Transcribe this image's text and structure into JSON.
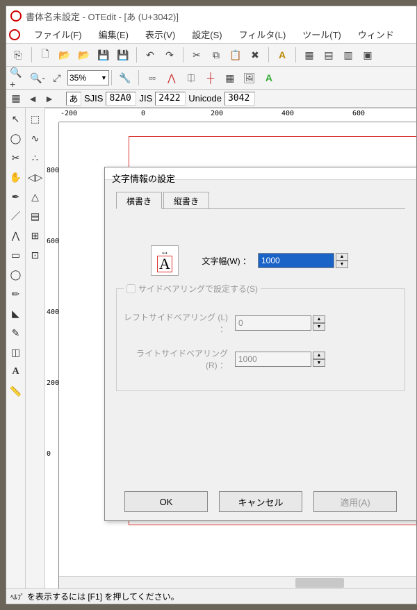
{
  "window": {
    "title": "書体名未設定 - OTEdit - [あ (U+3042)]"
  },
  "menu": {
    "file": "ファイル(F)",
    "edit": "編集(E)",
    "view": "表示(V)",
    "settings": "設定(S)",
    "filter": "フィルタ(L)",
    "tool": "ツール(T)",
    "window": "ウィンド"
  },
  "toolbar2": {
    "zoom": "35%"
  },
  "infobar": {
    "glyph": "あ",
    "enc1_label": "SJIS",
    "enc1_val": "82A0",
    "enc2_label": "JIS",
    "enc2_val": "2422",
    "enc3_label": "Unicode",
    "enc3_val": "3042"
  },
  "ruler_h": [
    "-200",
    "0",
    "200",
    "400",
    "600"
  ],
  "ruler_v": [
    "800",
    "600",
    "400",
    "200",
    "0"
  ],
  "dialog": {
    "title": "文字情報の設定",
    "tabs": {
      "horizontal": "横書き",
      "vertical": "縦書き"
    },
    "preview_letter": "A",
    "width_label": "文字幅(W) ：",
    "width_value": "1000",
    "sidebearing_check": "サイドベアリングで設定する(S)",
    "lsb_label": "レフトサイドベアリング (L) ：",
    "lsb_value": "0",
    "rsb_label": "ライトサイドベアリング (R) ：",
    "rsb_value": "1000",
    "ok": "OK",
    "cancel": "キャンセル",
    "apply": "適用(A)"
  },
  "status": {
    "hint_label": "ﾍﾙﾌﾟ",
    "hint": "を表示するには [F1] を押してください。"
  }
}
